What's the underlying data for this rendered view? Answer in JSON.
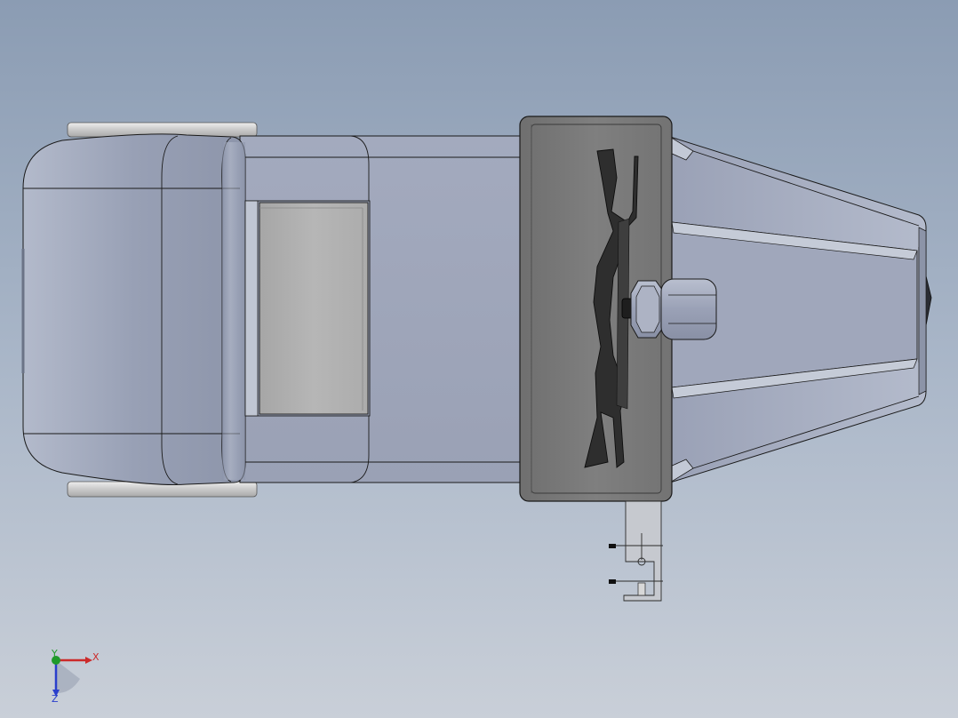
{
  "viewport": {
    "background_top": "#8b9cb3",
    "background_bottom": "#c9cfd8"
  },
  "model": {
    "body_color": "#9ea5ba",
    "cap_color": "#969eb3",
    "panel_color": "#b2b2b2",
    "housing_color": "#7c7c7c",
    "cone_color": "#a7aec2",
    "edge_color": "#1a1a1a"
  },
  "triad": {
    "x_label": "X",
    "y_label": "Y",
    "z_label": "Z",
    "x_color": "#cc2a2a",
    "y_color": "#1f9a2a",
    "z_color": "#2a3fcc"
  }
}
